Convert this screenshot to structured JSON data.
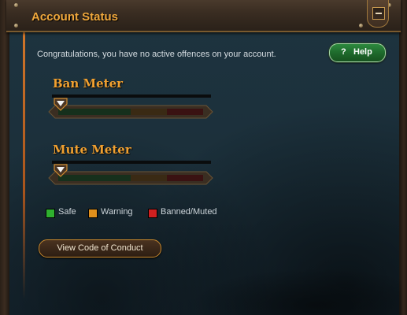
{
  "header": {
    "title": "Account Status",
    "collapse_icon": "minus-icon"
  },
  "intro_text": "Congratulations, you have no active offences on your account.",
  "help_button": {
    "icon": "?",
    "label": "Help"
  },
  "meters": [
    {
      "title": "Ban Meter",
      "level": 0
    },
    {
      "title": "Mute Meter",
      "level": 0
    }
  ],
  "legend": [
    {
      "label": "Safe",
      "color": "#2fb02f"
    },
    {
      "label": "Warning",
      "color": "#e0901c"
    },
    {
      "label": "Banned/Muted",
      "color": "#d02020"
    }
  ],
  "conduct_button": {
    "label": "View Code of Conduct"
  },
  "colors": {
    "accent": "#f0a030",
    "help_green": "#1e6a2c",
    "panel_bg": "#1e3440"
  }
}
